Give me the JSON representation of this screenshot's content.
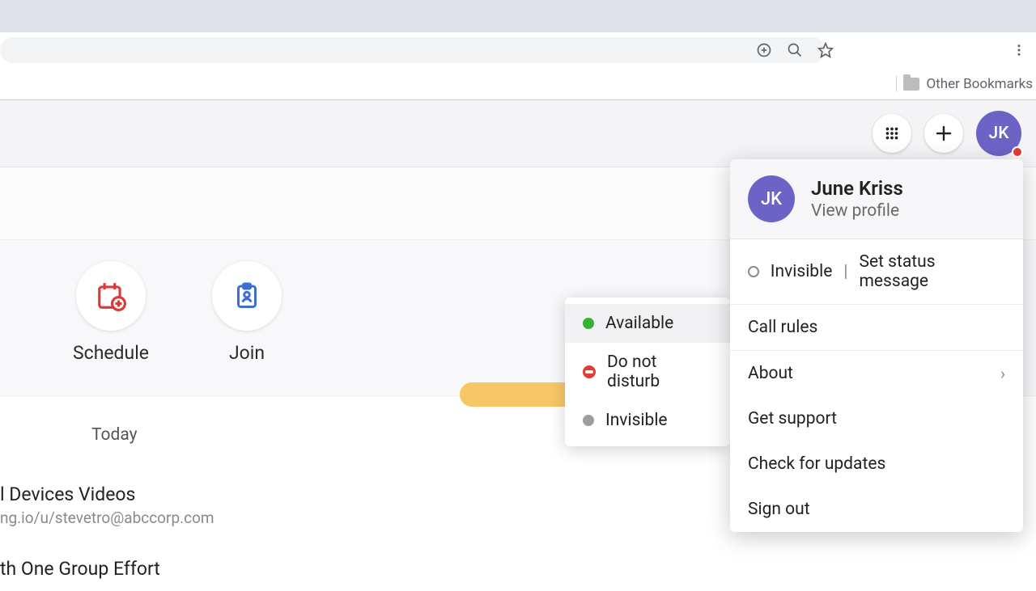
{
  "browser": {
    "other_bookmarks": "Other Bookmarks"
  },
  "header": {
    "avatar_initials": "JK"
  },
  "actions": {
    "schedule": "Schedule",
    "join": "Join"
  },
  "today_label": "Today",
  "events": [
    {
      "title": "l Devices Videos",
      "subtitle": "ng.io/u/stevetro@abccorp.com"
    },
    {
      "title": "th One Group Effort",
      "subtitle": ""
    }
  ],
  "status_options": {
    "available": "Available",
    "dnd": "Do not disturb",
    "invisible": "Invisible"
  },
  "profile": {
    "avatar_initials": "JK",
    "name": "June Kriss",
    "view_profile": "View profile",
    "current_status": "Invisible",
    "set_status": "Set status message",
    "call_rules": "Call rules",
    "about": "About",
    "get_support": "Get support",
    "check_updates": "Check for updates",
    "sign_out": "Sign out"
  }
}
